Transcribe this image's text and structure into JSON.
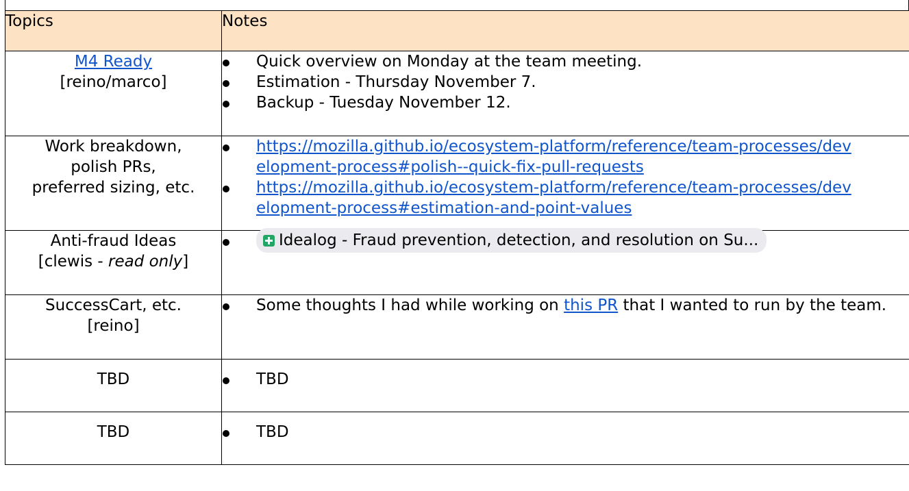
{
  "table": {
    "headers": {
      "topics": "Topics",
      "notes": "Notes"
    },
    "rows": [
      {
        "topic_link": "M4 Ready",
        "topic_sub": "[reino/marco]",
        "notes": [
          "Quick overview on Monday at the team meeting.",
          "Estimation - Thursday November 7.",
          "Backup - Tuesday November 12."
        ]
      },
      {
        "topic_lines": [
          "Work breakdown,",
          "polish PRs,",
          "preferred sizing, etc."
        ],
        "links": [
          "https://mozilla.github.io/ecosystem-platform/reference/team-processes/development-process#polish--quick-fix-pull-requests",
          "https://mozilla.github.io/ecosystem-platform/reference/team-processes/development-process#estimation-and-point-values"
        ]
      },
      {
        "topic_line1": "Anti-fraud Ideas",
        "topic_line2_prefix": "[clewis - ",
        "topic_line2_italic": "read only",
        "topic_line2_suffix": "]",
        "chip_icon": "google-sheets-icon",
        "chip_text": "Idealog - Fraud prevention, detection, and resolution on Su..."
      },
      {
        "topic_line1": "SuccessCart, etc.",
        "topic_line2": "[reino]",
        "note_before": "Some thoughts I had while working on ",
        "note_link": "this PR",
        "note_after": " that I wanted to run by the team."
      },
      {
        "topic": "TBD",
        "note": "TBD"
      },
      {
        "topic": "TBD",
        "note": "TBD"
      }
    ]
  },
  "colors": {
    "header_background": "#fde3c4",
    "link": "#1155cc",
    "chip_background": "#ebebef",
    "sheets_icon": "#23a566"
  }
}
